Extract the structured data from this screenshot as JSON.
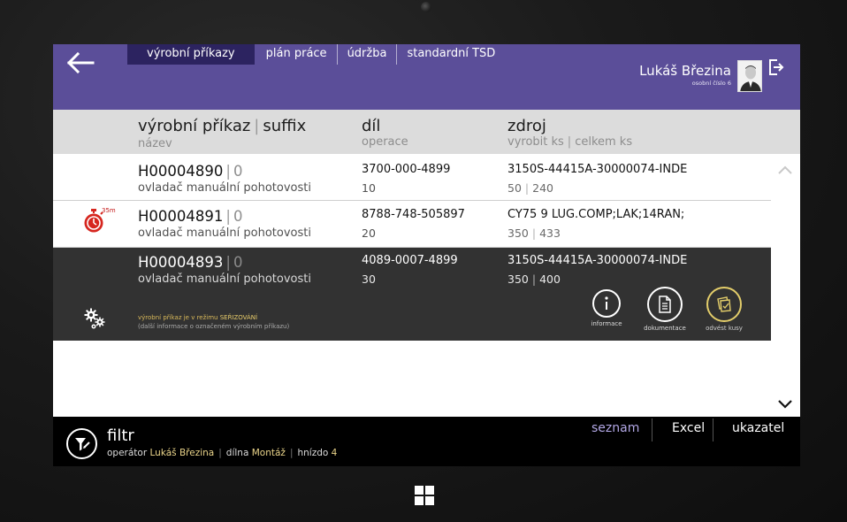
{
  "header": {
    "tabs": [
      {
        "label": "výrobní příkazy",
        "active": true
      },
      {
        "label": "plán práce",
        "active": false
      },
      {
        "label": "údržba",
        "active": false
      },
      {
        "label": "standardní TSD",
        "active": false
      }
    ],
    "user_name": "Lukáš Březina",
    "user_sub": "osobní číslo 6"
  },
  "columns": {
    "order": "výrobní příkaz",
    "suffix": "suffix",
    "name": "název",
    "part": "díl",
    "operation": "operace",
    "source": "zdroj",
    "produce_qty": "vyrobit ks",
    "total_qty": "celkem ks"
  },
  "rows": [
    {
      "order": "H00004890",
      "suffix": "0",
      "desc": "ovladač manuální pohotovosti",
      "part": "3700-000-4899",
      "op": "10",
      "source": "3150S-44415A-30000074-INDE",
      "produce": "50",
      "total": "240"
    },
    {
      "order": "H00004891",
      "suffix": "0",
      "desc": "ovladač manuální pohotovosti",
      "part": "8788-748-505897",
      "op": "20",
      "source": "CY75 9 LUG.COMP;LAK;14RAN;",
      "produce": "350",
      "total": "433",
      "timer": "35m"
    },
    {
      "order": "H00004893",
      "suffix": "0",
      "desc": "ovladač manuální pohotovosti",
      "part": "4089-0007-4899",
      "op": "30",
      "source": "3150S-44415A-30000074-INDE",
      "produce": "350",
      "total": "400"
    }
  ],
  "selected": {
    "mode_prefix": "výrobní příkaz je v režimu ",
    "mode_value": "SEŘIZOVÁNÍ",
    "mode_info": "(další informace o označeném výrobním příkazu)",
    "actions": [
      {
        "label": "informace",
        "icon": "info-icon"
      },
      {
        "label": "dokumentace",
        "icon": "document-icon"
      },
      {
        "label": "odvést kusy",
        "icon": "cards-icon"
      }
    ]
  },
  "footer": {
    "filter_title": "filtr",
    "operator_label": "operátor",
    "operator": "Lukáš Březina",
    "workshop_label": "dílna",
    "workshop": "Montáž",
    "nest_label": "hnízdo",
    "nest": "4",
    "buttons": [
      {
        "label": "seznam",
        "active": true
      },
      {
        "label": "Excel",
        "active": false
      },
      {
        "label": "ukazatel",
        "active": false
      }
    ]
  },
  "colors": {
    "header_bg": "#5b4e99",
    "active_tab_bg": "#2c2360",
    "timer_red": "#d6261f",
    "mode_yellow": "#d9b95a",
    "footer_active": "#b3a8e6"
  }
}
